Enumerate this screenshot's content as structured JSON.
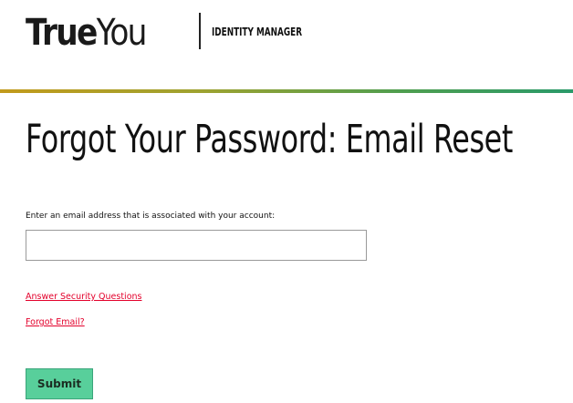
{
  "header": {
    "logo_strong": "True",
    "logo_light": "You",
    "subtitle": "IDENTITY MANAGER"
  },
  "page": {
    "title": "Forgot Your Password: Email Reset"
  },
  "form": {
    "instructions": "Enter an email address that is associated with your account:",
    "email_value": "",
    "email_placeholder": "",
    "submit_label": "Submit"
  },
  "links": {
    "security_questions": "Answer Security Questions",
    "forgot_email": "Forgot Email?"
  },
  "colors": {
    "link": "#e3002b",
    "submit_bg": "#58cf9b",
    "rule_start": "#c29a1b",
    "rule_end": "#2a9a6a"
  }
}
